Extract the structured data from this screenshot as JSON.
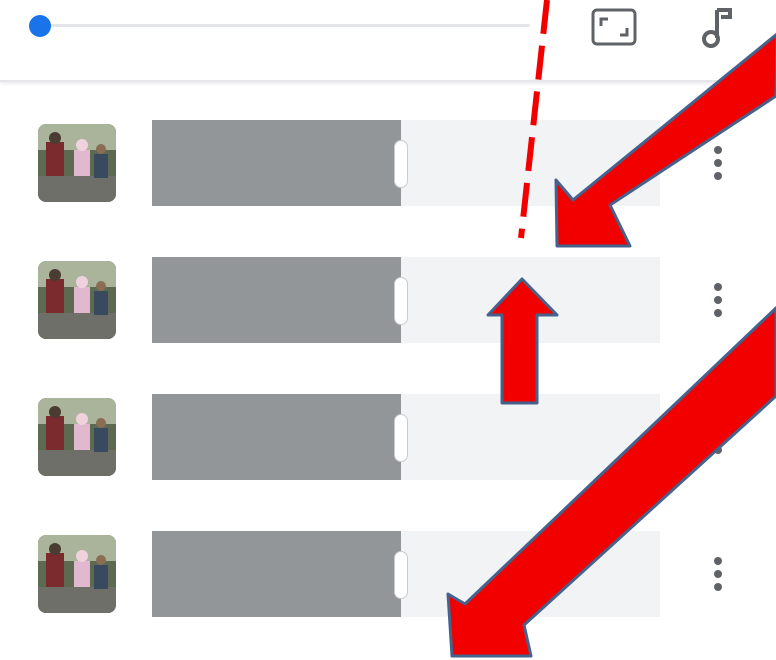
{
  "toolbar": {
    "scrubber_progress": 0.0,
    "icons": [
      "crop-icon",
      "music-note-icon"
    ]
  },
  "clips": [
    {
      "thumbnail": "thumbnail-children-walking",
      "fill_fraction": 0.49
    },
    {
      "thumbnail": "thumbnail-children-walking",
      "fill_fraction": 0.49
    },
    {
      "thumbnail": "thumbnail-children-walking",
      "fill_fraction": 0.49
    },
    {
      "thumbnail": "thumbnail-children-walking",
      "fill_fraction": 0.49
    }
  ],
  "annotation": {
    "arrow_color": "#f20000",
    "arrow_outline_color": "#45628d",
    "marker_line_style": "dashed"
  }
}
